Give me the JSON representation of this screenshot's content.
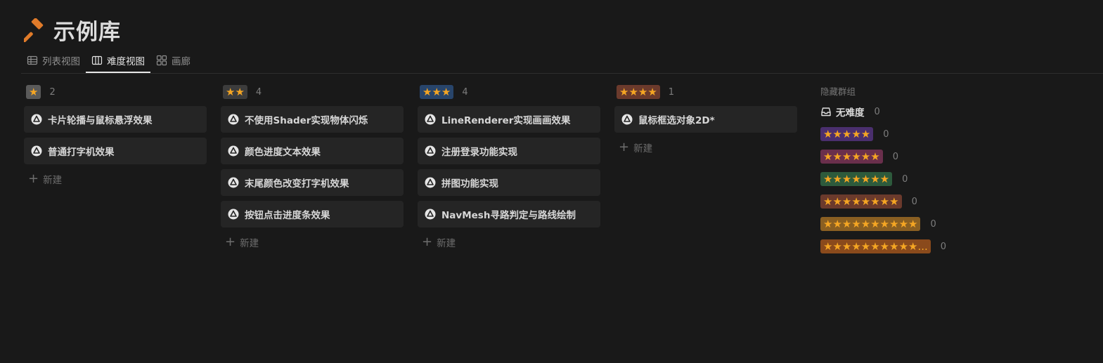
{
  "page": {
    "title": "示例库",
    "icon": "hammer-icon"
  },
  "tabs": [
    {
      "label": "列表视图",
      "icon": "table-icon",
      "active": false
    },
    {
      "label": "难度视图",
      "icon": "board-icon",
      "active": true
    },
    {
      "label": "画廊",
      "icon": "gallery-icon",
      "active": false
    }
  ],
  "columns": [
    {
      "stars": "★",
      "badge_color": "#5a5a5a",
      "count": "2",
      "cards": [
        "卡片轮播与鼠标悬浮效果",
        "普通打字机效果"
      ],
      "new_label": "新建"
    },
    {
      "stars": "★★",
      "badge_color": "#3c3c3c",
      "count": "4",
      "cards": [
        "不使用Shader实现物体闪烁",
        "颜色进度文本效果",
        "末尾颜色改变打字机效果",
        "按钮点击进度条效果"
      ],
      "new_label": "新建"
    },
    {
      "stars": "★★★",
      "badge_color": "#28456b",
      "count": "4",
      "cards": [
        "LineRenderer实现画画效果",
        "注册登录功能实现",
        "拼图功能实现",
        "NavMesh寻路判定与路线绘制"
      ],
      "new_label": "新建"
    },
    {
      "stars": "★★★★",
      "badge_color": "#6b3a2c",
      "count": "1",
      "cards": [
        "鼠标框选对象2D*"
      ],
      "new_label": "新建"
    }
  ],
  "hidden_groups": {
    "title": "隐藏群组",
    "no_difficulty": {
      "label": "无难度",
      "count": "0",
      "icon": "inbox-icon"
    },
    "groups": [
      {
        "stars": "★★★★★",
        "badge_color": "#4a2f6e",
        "count": "0"
      },
      {
        "stars": "★★★★★★",
        "badge_color": "#6a2f4c",
        "count": "0"
      },
      {
        "stars": "★★★★★★★",
        "badge_color": "#2d5a3c",
        "count": "0"
      },
      {
        "stars": "★★★★★★★★",
        "badge_color": "#6b3a2c",
        "count": "0"
      },
      {
        "stars": "★★★★★★★★★★",
        "badge_color": "#8a5f22",
        "count": "0"
      },
      {
        "stars": "★★★★★★★★★★...",
        "badge_color": "#8a4a1c",
        "count": "0"
      }
    ]
  },
  "colors": {
    "background": "#191919",
    "card": "#252525",
    "star": "#f5a623",
    "hammer": "#e07b2a"
  }
}
